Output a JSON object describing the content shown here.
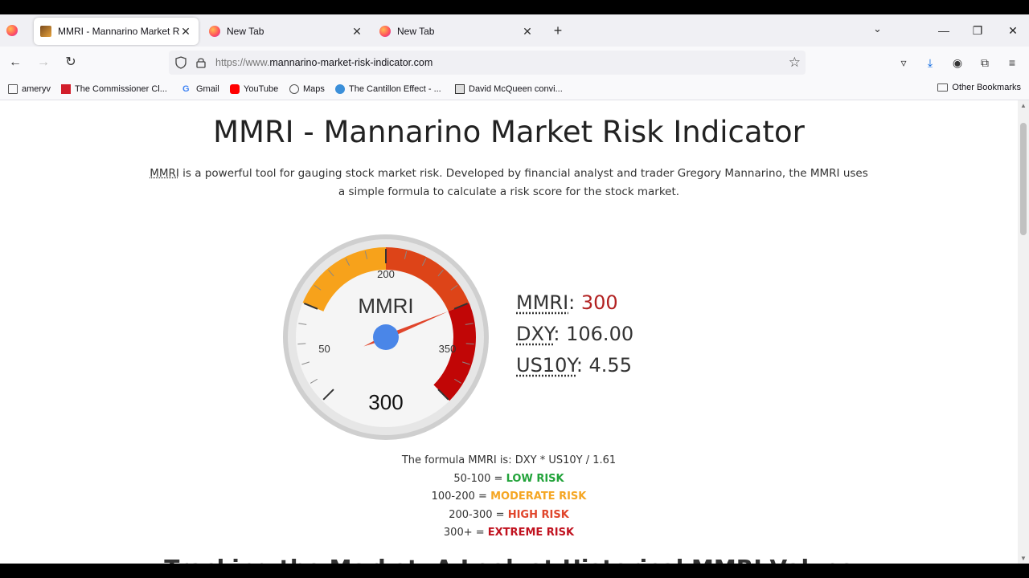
{
  "tabs": [
    {
      "label": "MMRI - Mannarino Market Risk",
      "active": true
    },
    {
      "label": "New Tab",
      "active": false
    },
    {
      "label": "New Tab",
      "active": false
    }
  ],
  "url": {
    "scheme": "https://www.",
    "host": "mannarino-market-risk-indicator.com"
  },
  "bookmarks": [
    {
      "label": "ameryv",
      "icon": "page-icon"
    },
    {
      "label": "The Commissioner Cl...",
      "icon": "red-bookmark-icon"
    },
    {
      "label": "Gmail",
      "icon": "google-icon"
    },
    {
      "label": "YouTube",
      "icon": "youtube-icon"
    },
    {
      "label": "Maps",
      "icon": "globe-icon"
    },
    {
      "label": "The Cantillon Effect - ...",
      "icon": "cantillon-icon"
    },
    {
      "label": "David McQueen convi...",
      "icon": "page-icon"
    }
  ],
  "other_bookmarks": "Other Bookmarks",
  "page": {
    "title": "MMRI - Mannarino Market Risk Indicator",
    "intro_abbr": "MMRI",
    "intro_rest": " is a powerful tool for gauging stock market risk. Developed by financial analyst and trader Gregory Mannarino, the MMRI uses a simple formula to calculate a risk score for the stock market.",
    "section_title": "Tracking the Market: A Look at Historical MMRI Values"
  },
  "gauge": {
    "label": "MMRI",
    "value": 300,
    "value_text": "300",
    "min": 0,
    "max": 400,
    "ticks": [
      "50",
      "200",
      "350"
    ],
    "bands": [
      {
        "from": 100,
        "to": 200,
        "color": "#f7a21b"
      },
      {
        "from": 200,
        "to": 300,
        "color": "#dd4418"
      },
      {
        "from": 300,
        "to": 400,
        "color": "#c10606"
      }
    ]
  },
  "readings": {
    "mmri_label": "MMRI",
    "mmri_value": "300",
    "dxy_label": "DXY",
    "dxy_value": "106.00",
    "us10y_label": "US10Y",
    "us10y_value": "4.55"
  },
  "formula": {
    "text": "The formula MMRI is: DXY * US10Y / 1.61",
    "rows": [
      {
        "range": "50-100 = ",
        "risk": "LOW RISK"
      },
      {
        "range": "100-200 = ",
        "risk": "MODERATE RISK"
      },
      {
        "range": "200-300 = ",
        "risk": "HIGH RISK"
      },
      {
        "range": "300+ = ",
        "risk": "EXTREME RISK"
      }
    ]
  },
  "colors": {
    "low": "#22a33a",
    "moderate": "#f5a623",
    "high": "#e0452b",
    "extreme": "#c1121f",
    "needle_hub": "#4a86e8"
  }
}
